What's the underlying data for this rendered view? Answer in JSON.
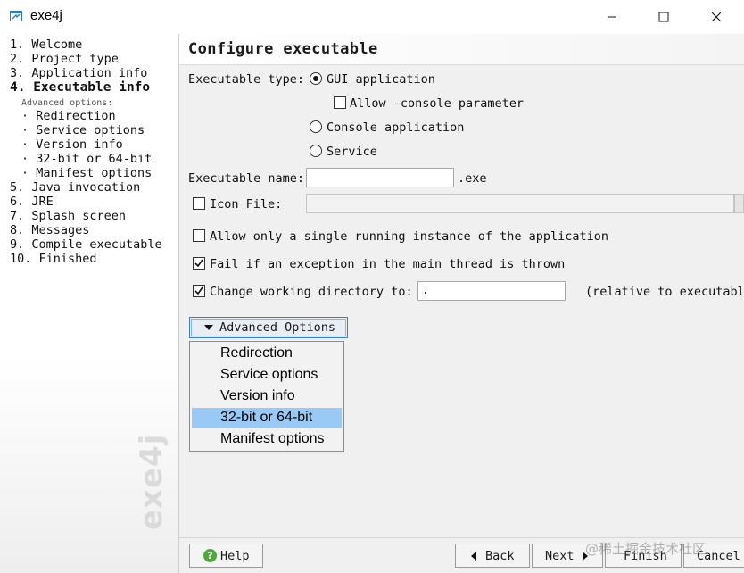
{
  "window": {
    "title": "exe4j",
    "controls": {
      "minimize": "minimize-icon",
      "maximize": "maximize-icon",
      "close": "close-icon"
    }
  },
  "sidebar": {
    "steps_top": [
      "1. Welcome",
      "2. Project type",
      "3. Application info"
    ],
    "current_step": "4. Executable info",
    "advanced_caption": "Advanced options:",
    "substeps": [
      "· Redirection",
      "· Service options",
      "· Version info",
      "· 32-bit or 64-bit",
      "· Manifest options"
    ],
    "steps_bottom": [
      "5. Java invocation",
      "6. JRE",
      "7. Splash screen",
      "8. Messages",
      "9. Compile executable",
      "10. Finished"
    ],
    "watermark": "exe4j"
  },
  "main": {
    "title": "Configure executable",
    "exe_type_label": "Executable type:",
    "type_gui": "GUI application",
    "allow_console": "Allow -console parameter",
    "type_console": "Console application",
    "type_service": "Service",
    "exe_name_label": "Executable name:",
    "exe_name_value": "",
    "exe_suffix": ".exe",
    "icon_file_label": "Icon File:",
    "icon_file_value": "",
    "single_instance": "Allow only a single running instance of the application",
    "fail_exception": "Fail if an exception in the main thread is thrown",
    "change_dir": "Change working directory to:",
    "change_dir_value": ".",
    "relative_note": "(relative to executable",
    "advanced_button": "Advanced Options",
    "menu_items": [
      "Redirection",
      "Service options",
      "Version info",
      "32-bit or 64-bit",
      "Manifest options"
    ],
    "selected_menu_item": "32-bit or 64-bit",
    "state": {
      "gui_selected": true,
      "allow_console_checked": false,
      "icon_file_checked": false,
      "single_instance_checked": false,
      "fail_exception_checked": true,
      "change_dir_checked": true
    }
  },
  "footer": {
    "help": "Help",
    "back": "Back",
    "next": "Next",
    "finish": "Finish",
    "cancel": "Cancel",
    "watermark": "@稀土掘金技术社区"
  },
  "colors": {
    "selection": "#99c9f5",
    "focus_border": "#3c7fd0",
    "help_green": "#4caa3c"
  }
}
